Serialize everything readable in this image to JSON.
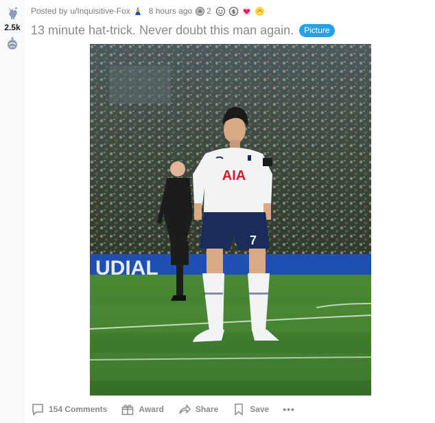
{
  "post": {
    "score": "2.5k",
    "meta": {
      "posted_by_prefix": "Posted by",
      "username": "u/Inquisitive-Fox",
      "time_ago": "8 hours ago",
      "award_count": "2"
    },
    "title": "13 minute hat-trick. Never doubt this man again.",
    "flair": "Picture",
    "image": {
      "shirt_sponsor": "AIA",
      "shirt_number": "7",
      "board_text": "UDIAL"
    }
  },
  "actions": {
    "comments_label": "154 Comments",
    "award_label": "Award",
    "share_label": "Share",
    "save_label": "Save",
    "more_label": "•••"
  },
  "colors": {
    "accent_flair": "#24a0ed",
    "meta_text": "#787c7e",
    "title_text": "#878a8c",
    "vote_column": "#f8f9fa",
    "pitch_green": "#3f7d2c",
    "ad_board_blue": "#1f4fb3"
  },
  "icons": {
    "upvote": "cockerel-upvote-icon",
    "downvote": "spurs-downvote-icon",
    "comments": "comment-bubble-icon",
    "award": "gift-icon",
    "share": "share-arrow-icon",
    "save": "bookmark-icon"
  }
}
